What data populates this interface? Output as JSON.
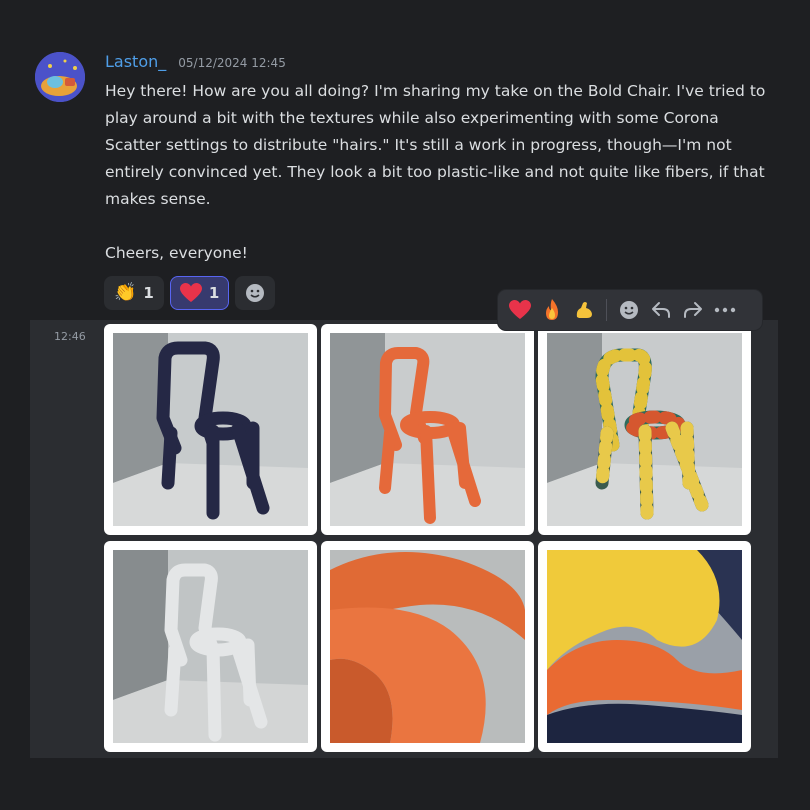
{
  "message": {
    "username": "Laston_",
    "timestamp": "05/12/2024 12:45",
    "paragraph1": "Hey there! How are you all doing? I'm sharing my take on the Bold Chair. I've tried to play around a bit with the textures while also experimenting with some Corona Scatter settings to distribute \"hairs.\" It's still a work in progress, though—I'm not entirely convinced yet. They look a bit too plastic-like and not quite like fibers, if that makes sense.",
    "paragraph2": "Cheers, everyone!"
  },
  "reactions": [
    {
      "icon": "clapping-hands-icon",
      "emoji": "👏",
      "count": "1",
      "active": false
    },
    {
      "icon": "red-heart-icon",
      "emoji": "❤",
      "count": "1",
      "active": true
    }
  ],
  "followup": {
    "timestamp": "12:46"
  },
  "toolbar": {
    "items": [
      "heart-icon",
      "fire-icon",
      "flexed-biceps-icon",
      "add-reaction-icon",
      "reply-icon",
      "forward-icon",
      "more-icon"
    ]
  },
  "colors": {
    "background": "#1e1f22",
    "username": "#4f9ee8",
    "active_reaction": "#373a6e",
    "accent": "#5865f2"
  },
  "images": [
    {
      "subject": "navy-chair"
    },
    {
      "subject": "orange-chair"
    },
    {
      "subject": "patterned-chair"
    },
    {
      "subject": "white-chair"
    },
    {
      "subject": "orange-closeup"
    },
    {
      "subject": "yellow-orange-closeup"
    }
  ]
}
